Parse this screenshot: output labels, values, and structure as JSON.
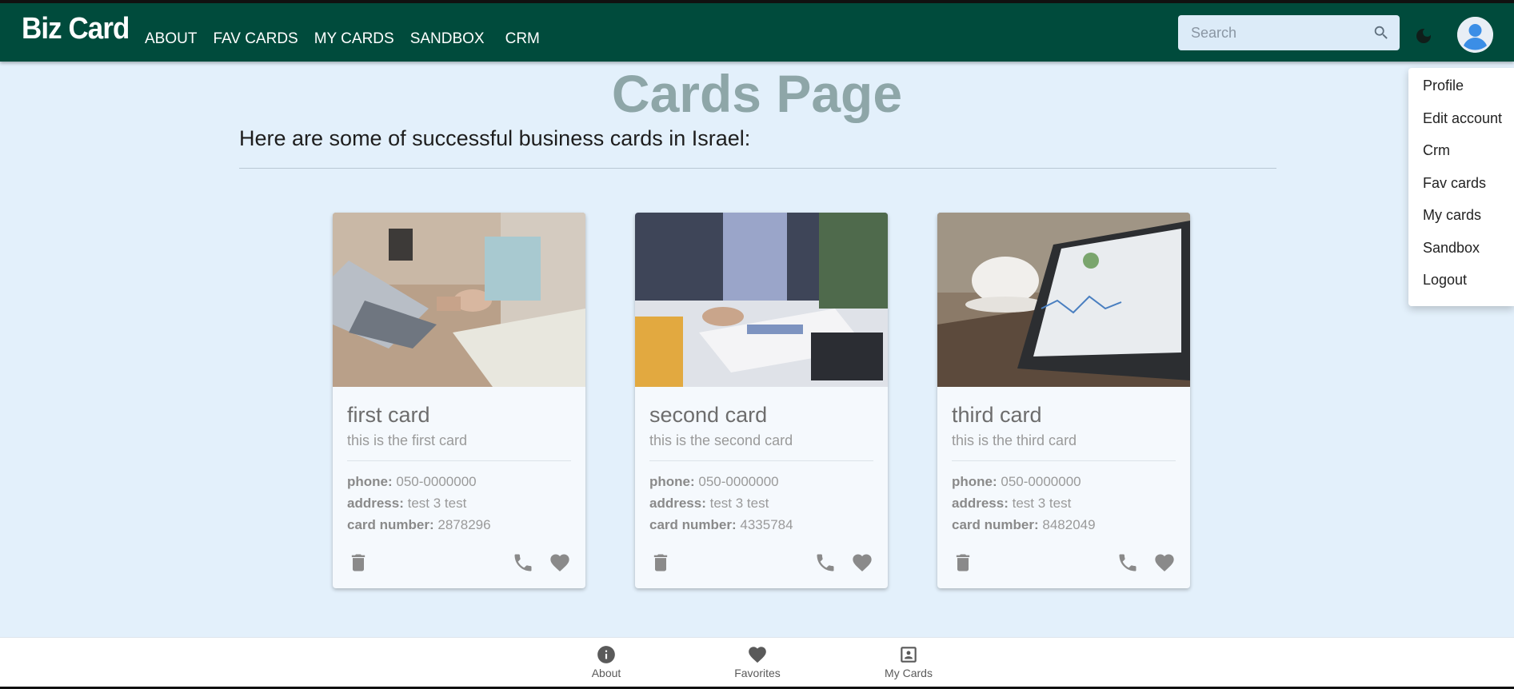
{
  "appbar": {
    "logo": "Biz Card",
    "nav": [
      "ABOUT",
      "FAV CARDS",
      "MY CARDS",
      "SANDBOX",
      "CRM"
    ],
    "search_placeholder": "Search"
  },
  "main": {
    "title": "Cards Page",
    "subtitle": "Here are some of successful business cards in Israel:"
  },
  "labels": {
    "phone": "phone:",
    "address": "address:",
    "card_number": "card number:"
  },
  "cards": [
    {
      "title": "first card",
      "subtitle": "this is the first card",
      "phone": "050-0000000",
      "address": "test 3 test",
      "card_number": "2878296"
    },
    {
      "title": "second card",
      "subtitle": "this is the second card",
      "phone": "050-0000000",
      "address": "test 3 test",
      "card_number": "4335784"
    },
    {
      "title": "third card",
      "subtitle": "this is the third card",
      "phone": "050-0000000",
      "address": "test 3 test",
      "card_number": "8482049"
    }
  ],
  "user_menu": [
    "Profile",
    "Edit account",
    "Crm",
    "Fav cards",
    "My cards",
    "Sandbox",
    "Logout"
  ],
  "bottom_nav": [
    "About",
    "Favorites",
    "My Cards"
  ],
  "colors": {
    "appbar": "#004b3c",
    "background": "#e3f0fb",
    "title": "#8ea6a8",
    "icon": "#8a8a8a"
  },
  "icons": [
    "search-icon",
    "moon-icon",
    "account-icon",
    "trash-icon",
    "phone-icon",
    "heart-icon",
    "info-icon",
    "portrait-icon"
  ]
}
